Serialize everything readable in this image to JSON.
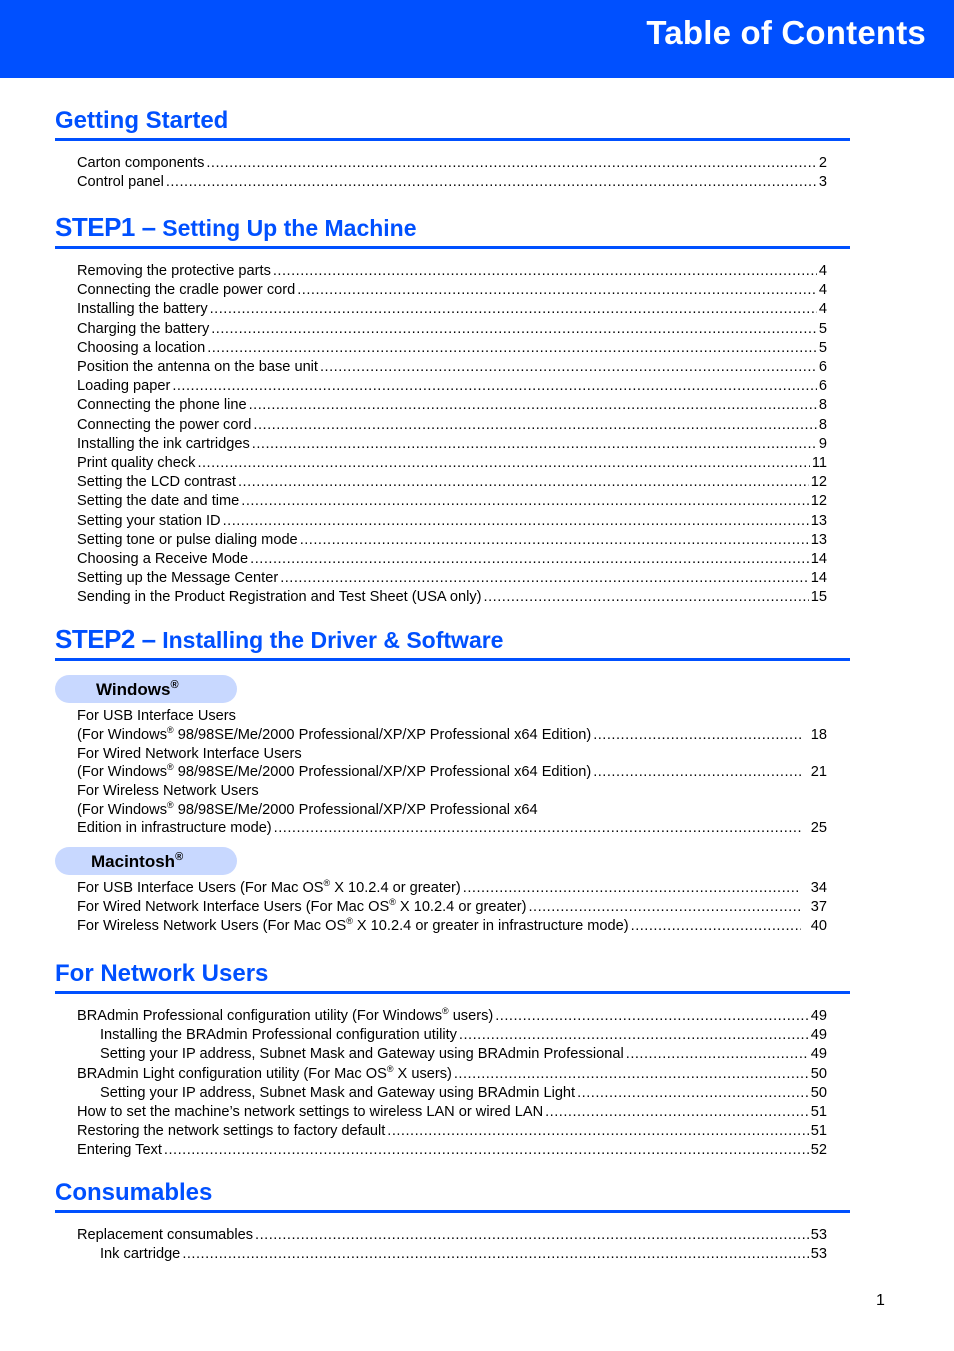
{
  "header": {
    "title": "Table of Contents",
    "bg_color": "#0050ff"
  },
  "sections": {
    "getting_started": {
      "title": "Getting Started",
      "entries": [
        {
          "label": "Carton components",
          "page": "2"
        },
        {
          "label": "Control panel",
          "page": "3"
        }
      ]
    },
    "step1": {
      "step": "STEP1 –",
      "title": "Setting Up the Machine",
      "entries": [
        {
          "label": "Removing the protective parts",
          "page": "4"
        },
        {
          "label": "Connecting the cradle power cord",
          "page": "4"
        },
        {
          "label": "Installing the battery",
          "page": "4"
        },
        {
          "label": "Charging the battery",
          "page": "5"
        },
        {
          "label": "Choosing a location",
          "page": "5"
        },
        {
          "label": "Position the antenna on the base unit",
          "page": "6"
        },
        {
          "label": "Loading paper",
          "page": "6"
        },
        {
          "label": "Connecting the phone line",
          "page": "8"
        },
        {
          "label": "Connecting the power cord",
          "page": "8"
        },
        {
          "label": "Installing the ink cartridges",
          "page": "9"
        },
        {
          "label": "Print quality check",
          "page": "11"
        },
        {
          "label": "Setting the LCD contrast",
          "page": "12"
        },
        {
          "label": "Setting the date and time",
          "page": "12"
        },
        {
          "label": "Setting your station ID",
          "page": "13"
        },
        {
          "label": "Setting tone or pulse dialing mode",
          "page": "13"
        },
        {
          "label": "Choosing a Receive Mode",
          "page": "14"
        },
        {
          "label": "Setting up the Message Center",
          "page": "14"
        },
        {
          "label": "Sending in the Product Registration and Test Sheet (USA only)",
          "page": "15"
        }
      ]
    },
    "step2": {
      "step": "STEP2 –",
      "title": "Installing the Driver & Software",
      "windows": {
        "pill": "Windows",
        "reg": "®",
        "usb_heading": "For USB Interface Users",
        "usb_pre": "(For Windows",
        "usb_post": " 98/98SE/Me/2000 Professional/XP/XP Professional x64 Edition)",
        "usb_page": "18",
        "wired_heading": "For Wired Network Interface Users",
        "wired_pre": "(For Windows",
        "wired_post": " 98/98SE/Me/2000 Professional/XP/XP Professional x64 Edition)",
        "wired_page": "21",
        "wireless_heading": "For Wireless Network Users",
        "wireless_pre": "(For Windows",
        "wireless_post": " 98/98SE/Me/2000 Professional/XP/XP Professional x64",
        "wireless_line2": "Edition in infrastructure mode)",
        "wireless_page": "25"
      },
      "mac": {
        "pill": "Macintosh",
        "reg": "®",
        "entries": [
          {
            "pre": "For USB Interface Users (For Mac OS",
            "post": " X 10.2.4 or greater)",
            "page": "34"
          },
          {
            "pre": "For Wired Network Interface Users (For Mac OS",
            "post": " X 10.2.4 or greater)",
            "page": "37"
          },
          {
            "pre": "For Wireless Network Users (For Mac OS",
            "post": " X 10.2.4 or greater in infrastructure mode)",
            "page": "40"
          }
        ]
      }
    },
    "network": {
      "title": "For Network Users",
      "reg": "®",
      "e0_pre": "BRAdmin Professional configuration utility (For Windows",
      "e0_post": " users)",
      "e0_page": "49",
      "e1": "Installing the BRAdmin Professional configuration utility",
      "e1_page": "49",
      "e2": "Setting your IP address, Subnet Mask and Gateway using BRAdmin Professional",
      "e2_page": "49",
      "e3_pre": "BRAdmin Light configuration utility (For Mac OS",
      "e3_post": " X users)",
      "e3_page": "50",
      "e4": "Setting your IP address, Subnet Mask and Gateway using BRAdmin Light",
      "e4_page": "50",
      "e5": "How to set the machine’s network settings to wireless LAN or wired LAN",
      "e5_page": "51",
      "e6": "Restoring the network settings to factory default",
      "e6_page": "51",
      "e7": "Entering Text",
      "e7_page": "52"
    },
    "consumables": {
      "title": "Consumables",
      "e0": "Replacement consumables",
      "e0_page": "53",
      "e1": "Ink cartridge",
      "e1_page": "53"
    }
  },
  "footer": {
    "page_number": "1"
  }
}
